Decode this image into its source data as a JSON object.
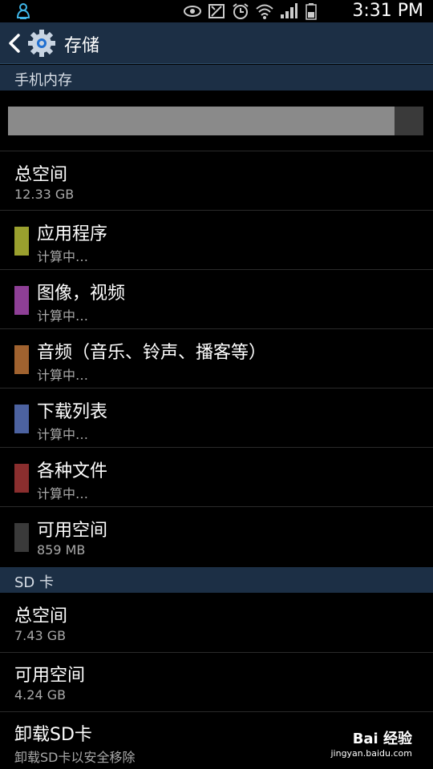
{
  "status_bar": {
    "time": "3:31 PM",
    "icons": [
      "notification-icon",
      "eye-icon",
      "nfc-icon",
      "alarm-icon",
      "wifi-icon",
      "signal-icon",
      "battery-icon"
    ]
  },
  "action_bar": {
    "title": "存储",
    "icons": [
      "back-icon",
      "settings-gear-icon"
    ]
  },
  "internal": {
    "header": "手机内存",
    "used_fraction": 0.93,
    "rows": [
      {
        "title": "总空间",
        "subtitle": "12.33 GB"
      },
      {
        "title": "应用程序",
        "subtitle": "计算中…",
        "color": "#9aa02e"
      },
      {
        "title": "图像，视频",
        "subtitle": "计算中…",
        "color": "#8e3f96"
      },
      {
        "title": "音频（音乐、铃声、播客等）",
        "subtitle": "计算中…",
        "color": "#a0622f"
      },
      {
        "title": "下载列表",
        "subtitle": "计算中…",
        "color": "#4c62a0"
      },
      {
        "title": "各种文件",
        "subtitle": "计算中…",
        "color": "#8a2e2e"
      },
      {
        "title": "可用空间",
        "subtitle": "859 MB",
        "color": "#3a3a3a"
      }
    ]
  },
  "sd": {
    "header": "SD 卡",
    "rows": [
      {
        "title": "总空间",
        "subtitle": "7.43 GB"
      },
      {
        "title": "可用空间",
        "subtitle": "4.24 GB"
      },
      {
        "title": "卸载SD卡",
        "subtitle": "卸载SD卡以安全移除"
      }
    ]
  },
  "watermark": {
    "brand": "Bai 经验",
    "url": "jingyan.baidu.com"
  }
}
